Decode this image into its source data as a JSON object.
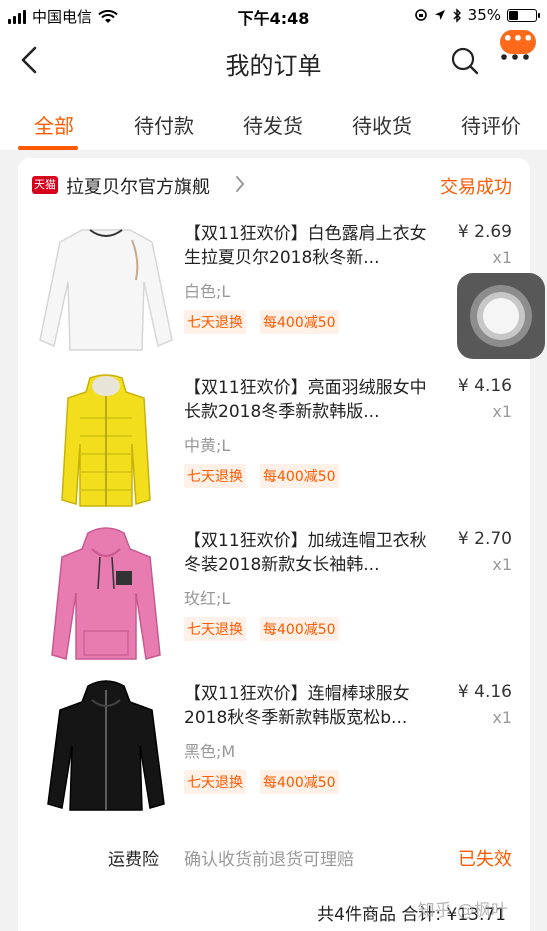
{
  "status_bar": {
    "carrier": "中国电信",
    "time": "下午4:48",
    "battery": "35%",
    "battery_level": 0.35
  },
  "nav": {
    "title": "我的订单",
    "message_badge": "•••",
    "back_icon": "chevron-left-icon",
    "search_icon": "search-icon",
    "more_icon": "more-dots-icon"
  },
  "tabs": [
    {
      "label": "全部",
      "active": true
    },
    {
      "label": "待付款",
      "active": false
    },
    {
      "label": "待发货",
      "active": false
    },
    {
      "label": "待收货",
      "active": false
    },
    {
      "label": "待评价",
      "active": false
    }
  ],
  "order": {
    "shop_badge": "天猫",
    "shop_name": "拉夏贝尔官方旗舰",
    "status": "交易成功",
    "items": [
      {
        "title": "【双11狂欢价】白色露肩上衣女生拉夏贝尔2018秋冬新...",
        "sku": "白色;L",
        "tags": [
          "七天退换",
          "每400减50"
        ],
        "price": "¥ 2.69",
        "qty": "x1",
        "color": "#f4f4f4"
      },
      {
        "title": "【双11狂欢价】亮面羽绒服女中长款2018冬季新款韩版...",
        "sku": "中黄;L",
        "tags": [
          "七天退换",
          "每400减50"
        ],
        "price": "¥ 4.16",
        "qty": "x1",
        "color": "#f2de1c"
      },
      {
        "title": "【双11狂欢价】加绒连帽卫衣秋冬装2018新款女长袖韩...",
        "sku": "玫红;L",
        "tags": [
          "七天退换",
          "每400减50"
        ],
        "price": "¥ 2.70",
        "qty": "x1",
        "color": "#e87bb0"
      },
      {
        "title": "【双11狂欢价】连帽棒球服女2018秋冬季新款韩版宽松b...",
        "sku": "黑色;M",
        "tags": [
          "七天退换",
          "每400减50"
        ],
        "price": "¥ 4.16",
        "qty": "x1",
        "color": "#151515"
      }
    ],
    "insurance": {
      "label": "运费险",
      "desc": "确认收货前退货可理赔",
      "status": "已失效"
    },
    "total": "共4件商品 合计: ¥13.71"
  },
  "watermark": "知乎 @枫叶",
  "colors": {
    "accent": "#ff5a00",
    "tmall_red": "#d6001c"
  }
}
